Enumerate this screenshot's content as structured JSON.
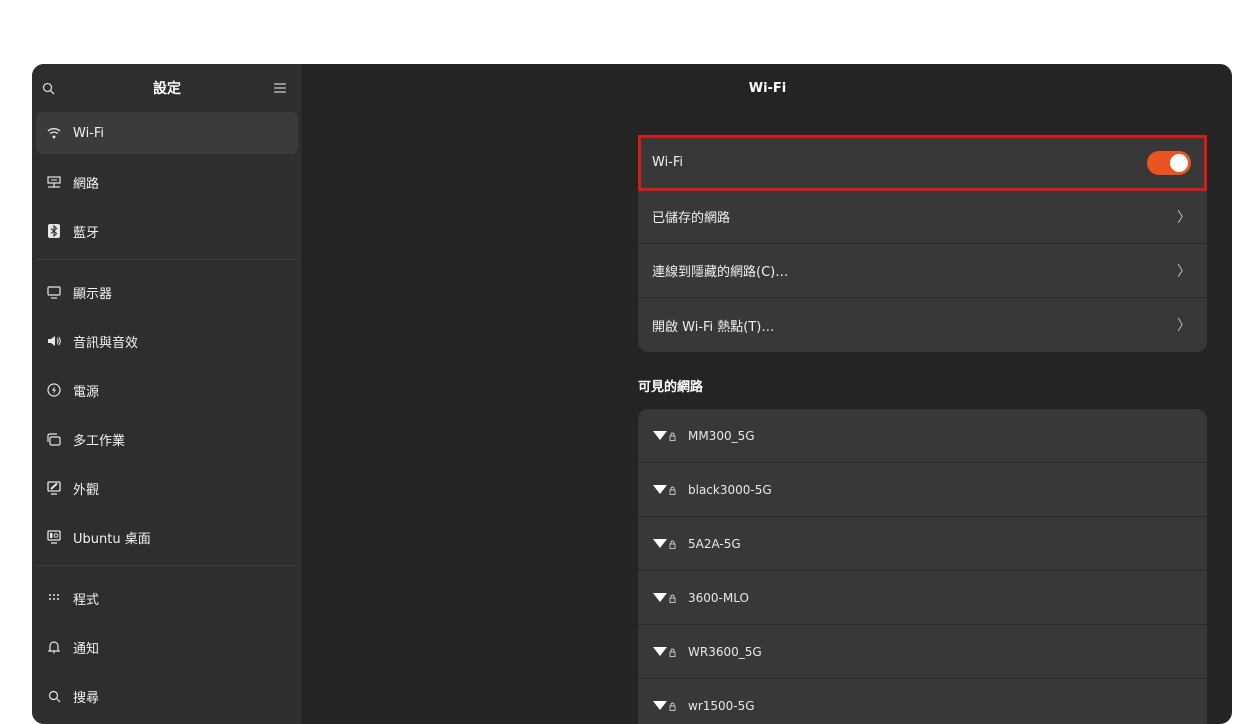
{
  "sidebar": {
    "title": "設定",
    "search_icon": "search-icon",
    "menu_icon": "hamburger-menu-icon",
    "groups": [
      [
        {
          "label": "Wi-Fi",
          "icon": "wifi-icon",
          "active": true
        },
        {
          "label": "網路",
          "icon": "network-icon"
        },
        {
          "label": "藍牙",
          "icon": "bluetooth-icon"
        }
      ],
      [
        {
          "label": "顯示器",
          "icon": "display-icon"
        },
        {
          "label": "音訊與音效",
          "icon": "speaker-icon"
        },
        {
          "label": "電源",
          "icon": "power-icon"
        },
        {
          "label": "多工作業",
          "icon": "multitasking-icon"
        },
        {
          "label": "外觀",
          "icon": "appearance-icon"
        },
        {
          "label": "Ubuntu 桌面",
          "icon": "ubuntu-desktop-icon"
        }
      ],
      [
        {
          "label": "程式",
          "icon": "apps-grid-icon"
        },
        {
          "label": "通知",
          "icon": "bell-icon"
        },
        {
          "label": "搜尋",
          "icon": "search-icon"
        }
      ]
    ]
  },
  "main": {
    "title": "Wi-Fi",
    "wifi_toggle": {
      "label": "Wi-Fi",
      "on": true
    },
    "options": [
      {
        "label": "已儲存的網路"
      },
      {
        "label": "連線到隱藏的網路(C)…"
      },
      {
        "label": "開啟 Wi-Fi 熱點(T)…"
      }
    ],
    "visible_networks_title": "可見的網路",
    "networks": [
      {
        "name": "MM300_5G"
      },
      {
        "name": "black3000-5G"
      },
      {
        "name": "5A2A-5G"
      },
      {
        "name": "3600-MLO"
      },
      {
        "name": "WR3600_5G"
      },
      {
        "name": "wr1500-5G"
      }
    ]
  },
  "colors": {
    "accent": "#e95420",
    "highlight_border": "#d71b1b",
    "window_bg": "#242424",
    "sidebar_bg": "#2e2e2e",
    "card_bg": "#383838"
  }
}
